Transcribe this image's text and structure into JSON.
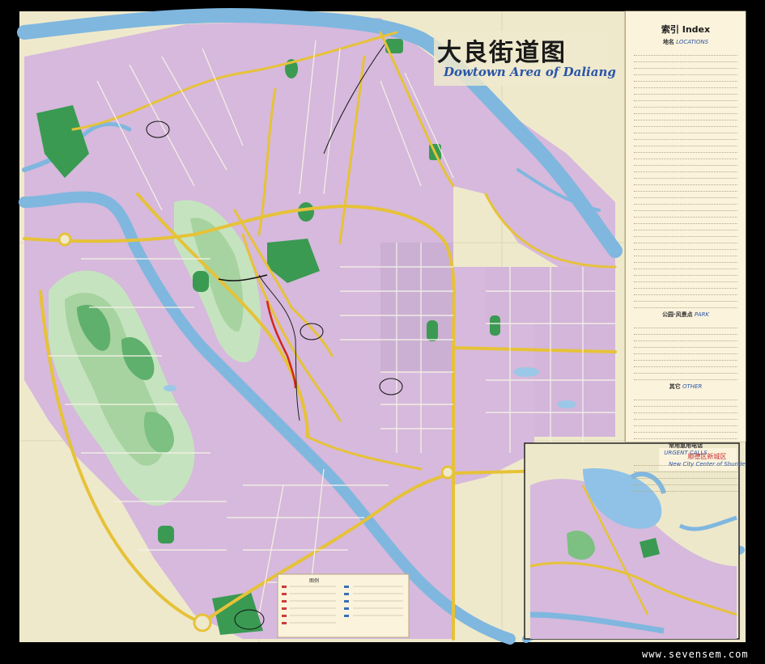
{
  "map": {
    "title_cn": "大良街道图",
    "title_en": "Dowtown Area of Daliang",
    "index": {
      "title": "索引 Index",
      "sections": [
        {
          "cn": "地名",
          "en": "LOCATIONS"
        },
        {
          "cn": "公园·风景点",
          "en": "PARK"
        },
        {
          "cn": "其它",
          "en": "OTHER"
        },
        {
          "cn": "常用急用电话",
          "en": "URGENT CALLS"
        }
      ]
    },
    "inset": {
      "title_cn": "顺德区新城区",
      "title_en": "New City Center of Shunde"
    },
    "legend_label": "图例",
    "watermark": "www.sevensem.com",
    "colors": {
      "urban": "#d6b9dc",
      "base": "#efe9cc",
      "water": "#7fb7df",
      "park": "#3a9a52",
      "road": "#e6c238",
      "frame": "#000000"
    }
  }
}
